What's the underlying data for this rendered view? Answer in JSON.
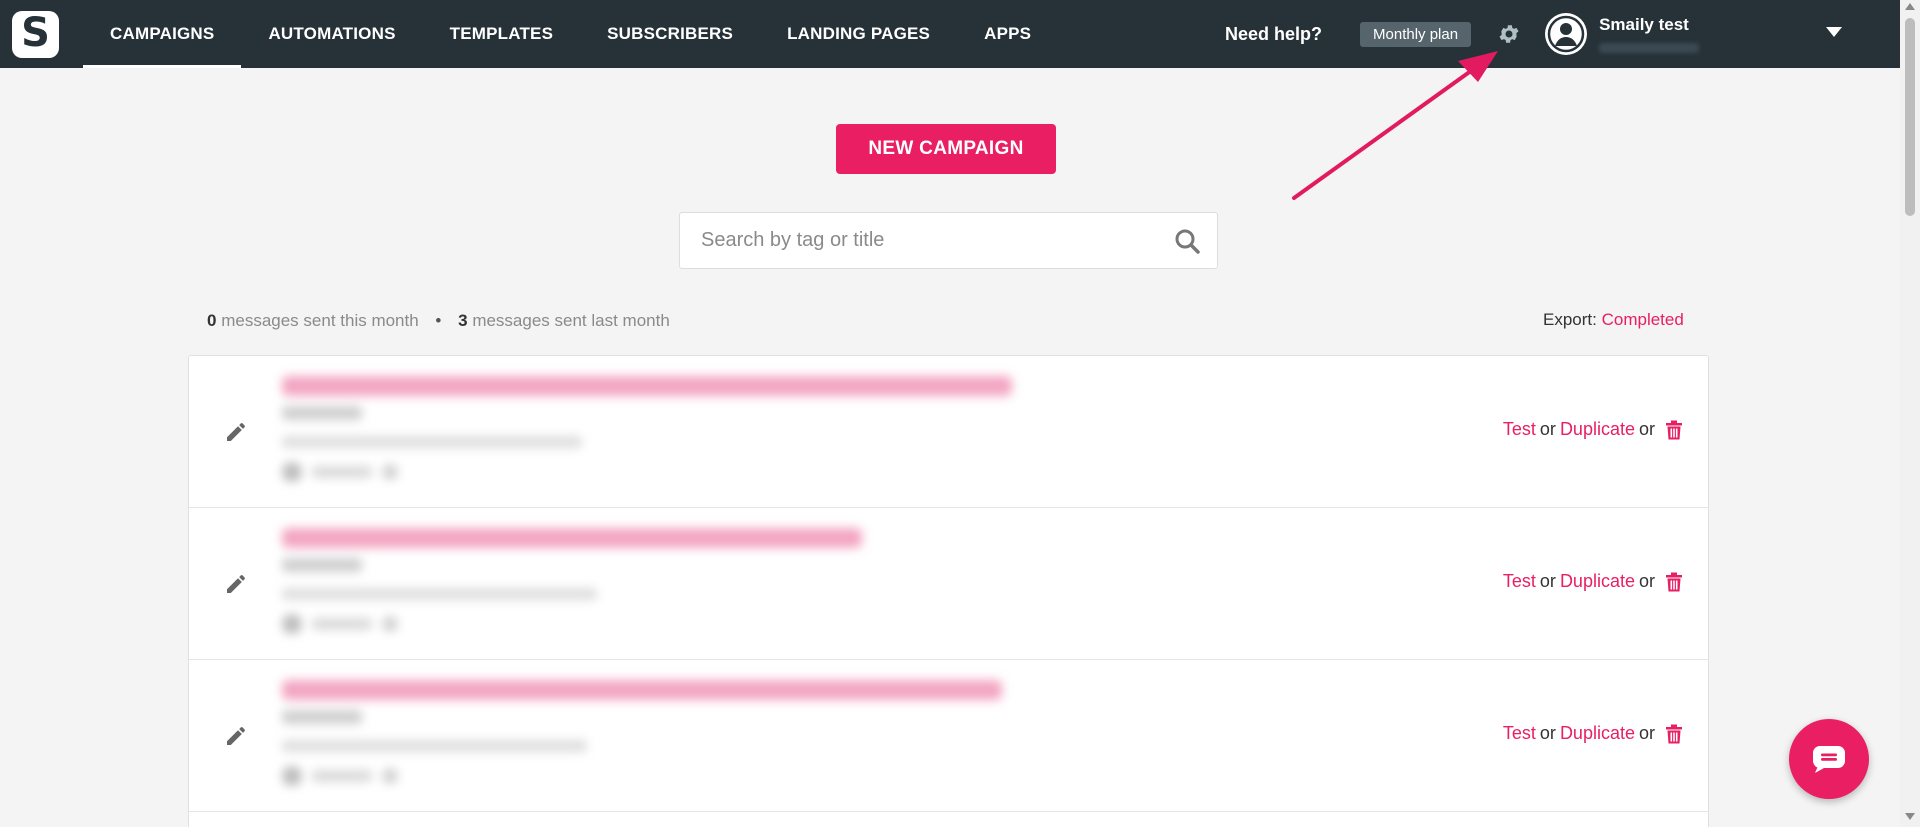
{
  "brand": {
    "logo_letter": "S"
  },
  "nav": {
    "items": [
      {
        "label": "CAMPAIGNS",
        "active": true
      },
      {
        "label": "AUTOMATIONS",
        "active": false
      },
      {
        "label": "TEMPLATES",
        "active": false
      },
      {
        "label": "SUBSCRIBERS",
        "active": false
      },
      {
        "label": "LANDING PAGES",
        "active": false
      },
      {
        "label": "APPS",
        "active": false
      }
    ],
    "help_label": "Need help?",
    "plan_label": "Monthly plan",
    "settings_icon": "gear-icon",
    "user_name": "Smaily test"
  },
  "main": {
    "new_campaign_label": "NEW CAMPAIGN",
    "search_placeholder": "Search by tag or title",
    "stats": {
      "sent_this_month_count": "0",
      "sent_this_month_label": "messages sent this month",
      "separator": "•",
      "sent_last_month_count": "3",
      "sent_last_month_label": "messages sent last month"
    },
    "export": {
      "label": "Export:",
      "value": "Completed"
    },
    "campaigns": [
      {
        "test_label": "Test",
        "or1": "or",
        "duplicate_label": "Duplicate",
        "or2": "or"
      },
      {
        "test_label": "Test",
        "or1": "or",
        "duplicate_label": "Duplicate",
        "or2": "or"
      },
      {
        "test_label": "Test",
        "or1": "or",
        "duplicate_label": "Duplicate",
        "or2": "or"
      }
    ]
  },
  "colors": {
    "nav_bg": "#263238",
    "accent": "#e91e63",
    "plan_bg": "#56646c",
    "page_bg": "#f4f4f4"
  }
}
